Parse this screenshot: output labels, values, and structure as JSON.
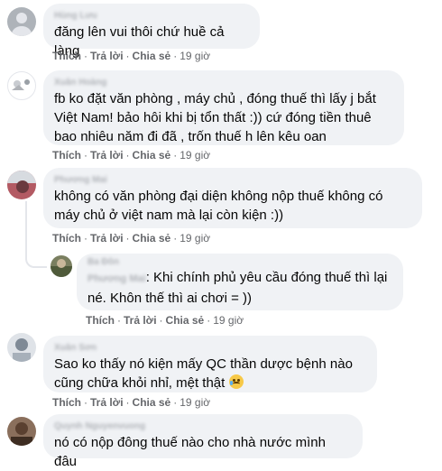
{
  "actions": {
    "like": "Thích",
    "reply": "Trả lời",
    "share": "Chia sẻ",
    "sep": "·"
  },
  "comments": [
    {
      "author": "Hùng Lưu",
      "text": "đăng lên vui thôi chứ huề cả làng",
      "time": "19 giờ"
    },
    {
      "author": "Xuân Hoàng",
      "text": "fb ko đặt văn phòng , máy chủ , đóng thuế thì lấy j bắt Việt Nam! bảo hôi khi bị tổn thất :)) cứ đóng tiền thuê bao nhiêu năm đi đã , trốn thuế h lên kêu oan",
      "time": "19 giờ"
    },
    {
      "author": "Phương Mai",
      "text": "không có văn phòng đại diện không nộp thuế không có máy chủ ở việt nam mà lại còn kiện :))",
      "time": "19 giờ"
    },
    {
      "author": "Ba Đôn",
      "mention": "Phương Mai",
      "text": ": Khi chính phủ yêu cầu đóng thuế thì lại né. Khôn thế thì ai chơi = ))",
      "time": "19 giờ"
    },
    {
      "author": "Xuân Sơn",
      "text": "Sao ko thấy nó kiện mấy QC thần dược bệnh nào cũng chữa khỏi nhỉ, mệt thật",
      "emoji": "crying-face",
      "time": "19 giờ"
    },
    {
      "author": "Quynh Nguyenvuong",
      "text": "nó có nộp đông thuế nào cho nhà nước mình đâu"
    }
  ]
}
